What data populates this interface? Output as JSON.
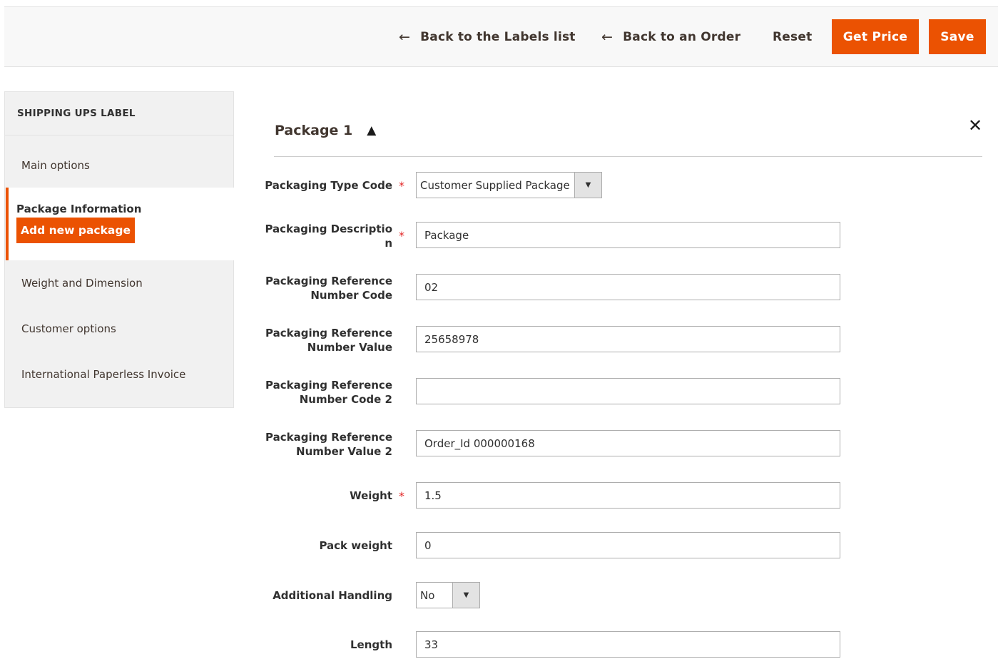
{
  "toolbar": {
    "back_labels": "Back to the Labels list",
    "back_order": "Back to an Order",
    "reset": "Reset",
    "get_price": "Get Price",
    "save": "Save",
    "accent_color": "#eb5202"
  },
  "sidebar": {
    "title": "SHIPPING UPS LABEL",
    "items": [
      {
        "label": "Main options"
      },
      {
        "label": "Package Information",
        "action": "Add new package"
      },
      {
        "label": "Weight and Dimension"
      },
      {
        "label": "Customer options"
      },
      {
        "label": "International Paperless Invoice"
      }
    ]
  },
  "package": {
    "title": "Package 1",
    "fields": {
      "packaging_type": {
        "label": "Packaging Type Code",
        "value": "Customer Supplied Package",
        "required": true
      },
      "packaging_desc": {
        "label_1": "Packaging Descriptio",
        "label_2": "n",
        "value": "Package",
        "required": true
      },
      "ref_code": {
        "label_1": "Packaging Reference",
        "label_2": "Number Code",
        "value": "02"
      },
      "ref_value": {
        "label_1": "Packaging Reference",
        "label_2": "Number Value",
        "value": "25658978"
      },
      "ref_code2": {
        "label_1": "Packaging Reference",
        "label_2": "Number Code 2",
        "value": ""
      },
      "ref_value2": {
        "label_1": "Packaging Reference",
        "label_2": "Number Value 2",
        "value": "Order_Id 000000168"
      },
      "weight": {
        "label": "Weight",
        "value": "1.5",
        "required": true
      },
      "pack_weight": {
        "label": "Pack weight",
        "value": "0"
      },
      "additional_handling": {
        "label": "Additional Handling",
        "value": "No"
      },
      "length": {
        "label": "Length",
        "value": "33"
      }
    }
  }
}
